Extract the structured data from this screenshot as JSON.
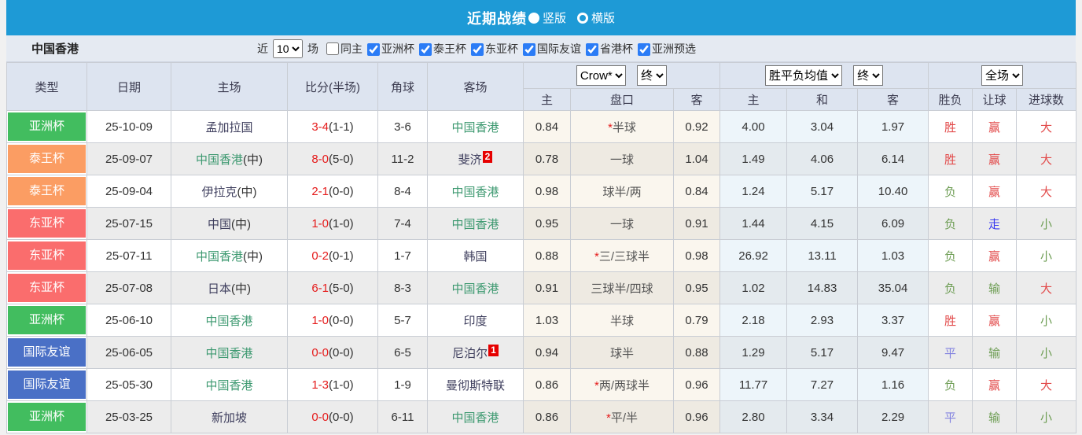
{
  "title_bar": {
    "title": "近期战绩",
    "options": [
      {
        "label": "竖版",
        "selected": true
      },
      {
        "label": "横版",
        "selected": false
      }
    ]
  },
  "filter_bar": {
    "team": "中国香港",
    "recent_label": "近",
    "recent_value": "10",
    "unit_label": "场",
    "same_home_label": "同主",
    "same_home_checked": false,
    "leagues": [
      "亚洲杯",
      "泰王杯",
      "东亚杯",
      "国际友谊",
      "省港杯",
      "亚洲预选"
    ]
  },
  "header_controls": {
    "bookmaker": "Crow*",
    "handicap_time": "终",
    "avg_label": "胜平负均值",
    "avg_time": "终",
    "scope": "全场"
  },
  "table": {
    "main_headers": [
      "类型",
      "日期",
      "主场",
      "比分(半场)",
      "角球",
      "客场"
    ],
    "sub_headers": [
      "主",
      "盘口",
      "客",
      "主",
      "和",
      "客",
      "胜负",
      "让球",
      "进球数"
    ],
    "rows": [
      {
        "type": "亚洲杯",
        "date": "25-10-09",
        "home": "孟加拉国",
        "home_tag": "",
        "score": "3-4",
        "half": "(1-1)",
        "corner": "3-6",
        "away": "中国香港",
        "away_card": "",
        "ah_home": "0.84",
        "handicap": "*半球",
        "ah_away": "0.92",
        "avg_home": "4.00",
        "avg_draw": "3.04",
        "avg_away": "1.97",
        "res_wdl": {
          "t": "胜",
          "c": "red"
        },
        "res_ah": {
          "t": "赢",
          "c": "red"
        },
        "res_ou": {
          "t": "大",
          "c": "red"
        }
      },
      {
        "type": "泰王杯",
        "date": "25-09-07",
        "home": "中国香港",
        "home_tag": "(中)",
        "score": "8-0",
        "half": "(5-0)",
        "corner": "11-2",
        "away": "斐济",
        "away_card": "2",
        "ah_home": "0.78",
        "handicap": "一球",
        "ah_away": "1.04",
        "avg_home": "1.49",
        "avg_draw": "4.06",
        "avg_away": "6.14",
        "res_wdl": {
          "t": "胜",
          "c": "red"
        },
        "res_ah": {
          "t": "赢",
          "c": "red"
        },
        "res_ou": {
          "t": "大",
          "c": "red"
        }
      },
      {
        "type": "泰王杯",
        "date": "25-09-04",
        "home": "伊拉克",
        "home_tag": "(中)",
        "score": "2-1",
        "half": "(0-0)",
        "corner": "8-4",
        "away": "中国香港",
        "away_card": "",
        "ah_home": "0.98",
        "handicap": "球半/两",
        "ah_away": "0.84",
        "avg_home": "1.24",
        "avg_draw": "5.17",
        "avg_away": "10.40",
        "res_wdl": {
          "t": "负",
          "c": "green"
        },
        "res_ah": {
          "t": "赢",
          "c": "red"
        },
        "res_ou": {
          "t": "大",
          "c": "red"
        }
      },
      {
        "type": "东亚杯",
        "date": "25-07-15",
        "home": "中国",
        "home_tag": "(中)",
        "score": "1-0",
        "half": "(1-0)",
        "corner": "7-4",
        "away": "中国香港",
        "away_card": "",
        "ah_home": "0.95",
        "handicap": "一球",
        "ah_away": "0.91",
        "avg_home": "1.44",
        "avg_draw": "4.15",
        "avg_away": "6.09",
        "res_wdl": {
          "t": "负",
          "c": "green"
        },
        "res_ah": {
          "t": "走",
          "c": "walk"
        },
        "res_ou": {
          "t": "小",
          "c": "green"
        }
      },
      {
        "type": "东亚杯",
        "date": "25-07-11",
        "home": "中国香港",
        "home_tag": "(中)",
        "score": "0-2",
        "half": "(0-1)",
        "corner": "1-7",
        "away": "韩国",
        "away_card": "",
        "ah_home": "0.88",
        "handicap": "*三/三球半",
        "ah_away": "0.98",
        "avg_home": "26.92",
        "avg_draw": "13.11",
        "avg_away": "1.03",
        "res_wdl": {
          "t": "负",
          "c": "green"
        },
        "res_ah": {
          "t": "赢",
          "c": "red"
        },
        "res_ou": {
          "t": "小",
          "c": "green"
        }
      },
      {
        "type": "东亚杯",
        "date": "25-07-08",
        "home": "日本",
        "home_tag": "(中)",
        "score": "6-1",
        "half": "(5-0)",
        "corner": "8-3",
        "away": "中国香港",
        "away_card": "",
        "ah_home": "0.91",
        "handicap": "三球半/四球",
        "ah_away": "0.95",
        "avg_home": "1.02",
        "avg_draw": "14.83",
        "avg_away": "35.04",
        "res_wdl": {
          "t": "负",
          "c": "green"
        },
        "res_ah": {
          "t": "输",
          "c": "green"
        },
        "res_ou": {
          "t": "大",
          "c": "red"
        }
      },
      {
        "type": "亚洲杯",
        "date": "25-06-10",
        "home": "中国香港",
        "home_tag": "",
        "score": "1-0",
        "half": "(0-0)",
        "corner": "5-7",
        "away": "印度",
        "away_card": "",
        "ah_home": "1.03",
        "handicap": "半球",
        "ah_away": "0.79",
        "avg_home": "2.18",
        "avg_draw": "2.93",
        "avg_away": "3.37",
        "res_wdl": {
          "t": "胜",
          "c": "red"
        },
        "res_ah": {
          "t": "赢",
          "c": "red"
        },
        "res_ou": {
          "t": "小",
          "c": "green"
        }
      },
      {
        "type": "国际友谊",
        "date": "25-06-05",
        "home": "中国香港",
        "home_tag": "",
        "score": "0-0",
        "half": "(0-0)",
        "corner": "6-5",
        "away": "尼泊尔",
        "away_card": "1",
        "ah_home": "0.94",
        "handicap": "球半",
        "ah_away": "0.88",
        "avg_home": "1.29",
        "avg_draw": "5.17",
        "avg_away": "9.47",
        "res_wdl": {
          "t": "平",
          "c": "draw"
        },
        "res_ah": {
          "t": "输",
          "c": "green"
        },
        "res_ou": {
          "t": "小",
          "c": "green"
        }
      },
      {
        "type": "国际友谊",
        "date": "25-05-30",
        "home": "中国香港",
        "home_tag": "",
        "score": "1-3",
        "half": "(1-0)",
        "corner": "1-9",
        "away": "曼彻斯特联",
        "away_card": "",
        "ah_home": "0.86",
        "handicap": "*两/两球半",
        "ah_away": "0.96",
        "avg_home": "11.77",
        "avg_draw": "7.27",
        "avg_away": "1.16",
        "res_wdl": {
          "t": "负",
          "c": "green"
        },
        "res_ah": {
          "t": "赢",
          "c": "red"
        },
        "res_ou": {
          "t": "大",
          "c": "red"
        }
      },
      {
        "type": "亚洲杯",
        "date": "25-03-25",
        "home": "新加坡",
        "home_tag": "",
        "score": "0-0",
        "half": "(0-0)",
        "corner": "6-11",
        "away": "中国香港",
        "away_card": "",
        "ah_home": "0.86",
        "handicap": "*平/半",
        "ah_away": "0.96",
        "avg_home": "2.80",
        "avg_draw": "3.34",
        "avg_away": "2.29",
        "res_wdl": {
          "t": "平",
          "c": "draw"
        },
        "res_ah": {
          "t": "输",
          "c": "green"
        },
        "res_ou": {
          "t": "小",
          "c": "green"
        }
      }
    ]
  },
  "type_colors": {
    "亚洲杯": "#42bd5f",
    "泰王杯": "#fb9d63",
    "东亚杯": "#fa6d6d",
    "国际友谊": "#4a70c6"
  },
  "result_colors": {
    "red": "#e24a4a",
    "green": "#6f9e56",
    "draw": "#8282e0",
    "walk": "#3a3af0"
  },
  "hk_name": "中国香港",
  "accent": {
    "titlebar_blue": "#1e9ad6",
    "header_bg": "#dde4f0",
    "checkbox_blue": "#2b7cf6"
  }
}
